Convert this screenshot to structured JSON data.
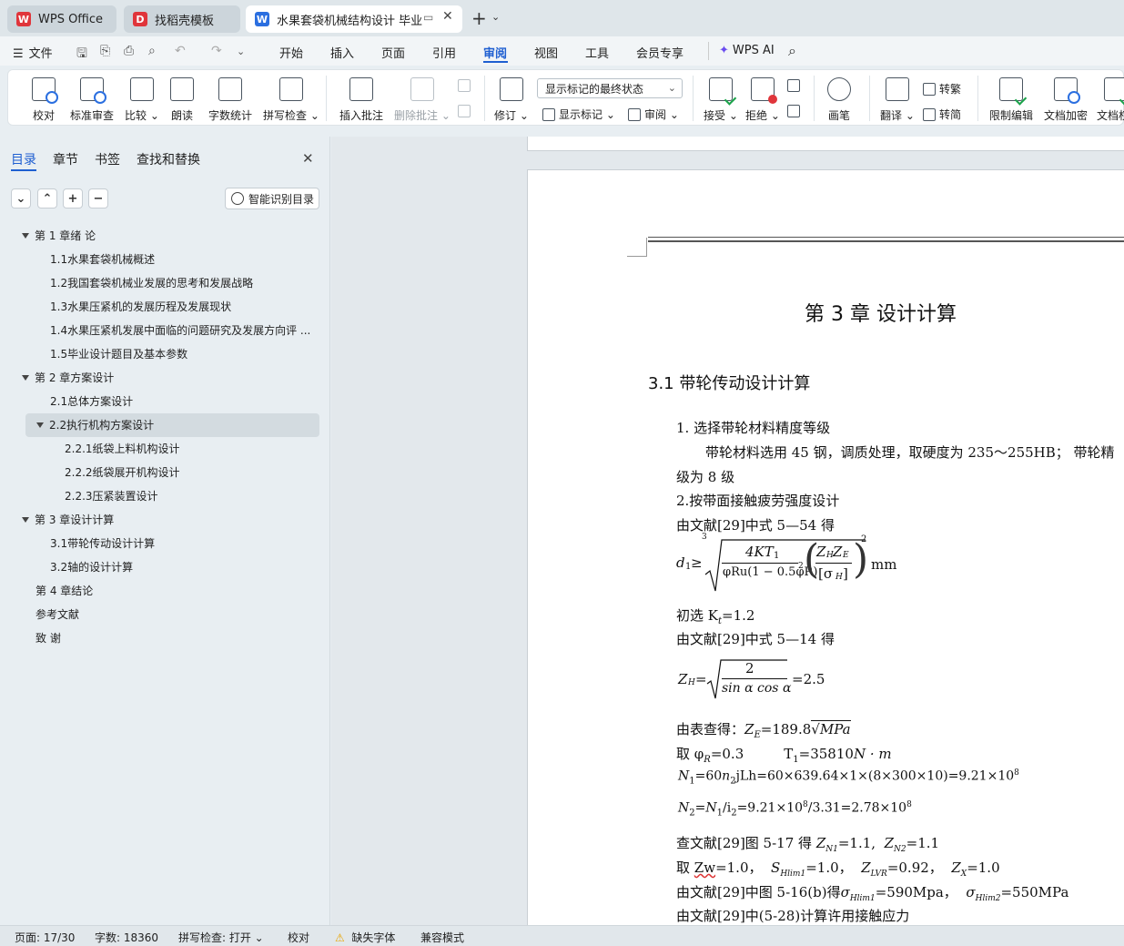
{
  "tabs": [
    {
      "label": "WPS Office",
      "logo": "W"
    },
    {
      "label": "找稻壳模板",
      "logo": "D"
    },
    {
      "label": "水果套袋机械结构设计 毕业",
      "logo": "W"
    }
  ],
  "colors": {
    "accent": "#1f5fd1",
    "wps_red": "#e0353b",
    "word_blue": "#2b6fe0"
  },
  "menu": {
    "file": "文件",
    "items": [
      "开始",
      "插入",
      "页面",
      "引用",
      "审阅",
      "视图",
      "工具",
      "会员专享"
    ],
    "active": "审阅",
    "wps_ai": "WPS AI"
  },
  "ribbon": {
    "proofread": "校对",
    "standard_review": "标准审查",
    "compare": "比较",
    "read_aloud": "朗读",
    "word_count": "字数统计",
    "spell_check": "拼写检查",
    "insert_comment": "插入批注",
    "delete_comment": "删除批注",
    "revise": "修订",
    "display_state": "显示标记的最终状态",
    "show_markup": "显示标记",
    "review": "审阅",
    "accept": "接受",
    "reject": "拒绝",
    "pen": "画笔",
    "translate": "翻译",
    "to_traditional": "转繁",
    "to_simplified": "转简",
    "restrict_edit": "限制编辑",
    "doc_encrypt": "文档加密",
    "doc_permission": "文档权"
  },
  "sidebar": {
    "tabs": [
      "目录",
      "章节",
      "书签",
      "查找和替换"
    ],
    "ai_button": "智能识别目录",
    "toc": [
      {
        "text": "第 1 章绪  论",
        "level": 1,
        "expanded": true
      },
      {
        "text": "1.1水果套袋机械概述",
        "level": 2
      },
      {
        "text": "1.2我国套袋机械业发展的思考和发展战略",
        "level": 2
      },
      {
        "text": "1.3水果压紧机的发展历程及发展现状",
        "level": 2
      },
      {
        "text": "1.4水果压紧机发展中面临的问题研究及发展方向评 ...",
        "level": 2
      },
      {
        "text": "1.5毕业设计题目及基本参数",
        "level": 2
      },
      {
        "text": "第 2 章方案设计",
        "level": 1,
        "expanded": true
      },
      {
        "text": "2.1总体方案设计",
        "level": 2
      },
      {
        "text": "2.2执行机构方案设计",
        "level": 2,
        "expanded": true,
        "selected": true
      },
      {
        "text": "2.2.1纸袋上料机构设计",
        "level": 3
      },
      {
        "text": "2.2.2纸袋展开机构设计",
        "level": 3
      },
      {
        "text": "2.2.3压紧装置设计",
        "level": 3
      },
      {
        "text": "第 3 章设计计算",
        "level": 1,
        "expanded": true
      },
      {
        "text": "3.1带轮传动设计计算",
        "level": 2
      },
      {
        "text": "3.2轴的设计计算",
        "level": 2
      },
      {
        "text": "第 4 章结论",
        "level": 1
      },
      {
        "text": "参考文献",
        "level": 1
      },
      {
        "text": "致  谢",
        "level": 1
      }
    ]
  },
  "document": {
    "chapter_title": "第 3 章  设计计算",
    "section_title": "3.1  带轮传动设计计算",
    "p1": "1. 选择带轮材料精度等级",
    "p2": "带轮材料选用 45 钢，调质处理，取硬度为 235～255HB；  带轮精",
    "p3": "级为 8 级",
    "p4": "2.按带面接触疲劳强度设计",
    "p5": "由文献[29]中式 5—54 得",
    "f1_left": "d",
    "f1_sub": "1",
    "f1_ge": "≥",
    "f1_root_index": "3",
    "f1_num": "4KT",
    "f1_num_sub": "1",
    "f1_den": "φRu(1 − 0.5φR)",
    "f1_den_exp": "2",
    "f1_rnum": "Z",
    "f1_rnum_a": "H",
    "f1_rnum_b": "E",
    "f1_rden": "[σ",
    "f1_rden_sub": "H",
    "f1_rden_end": "]",
    "f1_exp": "2",
    "f1_unit": "mm",
    "p6": "初选 K",
    "p6_sub": "t",
    "p6_val": "=1.2",
    "p7": "由文献[29]中式 5—14 得",
    "f2_left": "Z",
    "f2_left_sub": "H",
    "f2_eq": "=",
    "f2_num": "2",
    "f2_den": "sin α cos α",
    "f2_val": "=2.5",
    "p8": "由表查得：",
    "p8_z": "Z",
    "p8_zsub": "E",
    "p8_val": "=189.8",
    "p8_root": "MPa",
    "p9": "取 φ",
    "p9_sub": "R",
    "p9_val": "=0.3",
    "p9_t": "T",
    "p9_tsub": "1",
    "p9_tval": "=35810",
    "p9_unit": "N · m",
    "p10": "N",
    "p10_sub": "1",
    "p10_val": "=60",
    "p10_n": "n",
    "p10_nsub": "2",
    "p10_rest": "jLh=60×639.64×1×(8×300×10)=9.21×10",
    "p10_exp": "8",
    "p11": "N",
    "p11_sub": "2",
    "p11_eq": "=",
    "p11_n": "N",
    "p11_nsub": "1",
    "p11_i": "/i",
    "p11_isub": "2",
    "p11_rest": "=9.21×10",
    "p11_exp1": "8",
    "p11_rest2": "/3.31=2.78×10",
    "p11_exp2": "8",
    "p12": "查文献[29]图 5-17 得",
    "p12_z1": "Z",
    "p12_z1sub": "N1",
    "p12_z1val": "=1.1,",
    "p12_z2": "Z",
    "p12_z2sub": "N2",
    "p12_z2val": "=1.1",
    "p13": "取",
    "p13_zw": "Zw",
    "p13_zwval": "=1.0，",
    "p13_s": "S",
    "p13_ssub": "Hlim1",
    "p13_sval": "=1.0，",
    "p13_zl": "Z",
    "p13_zlsub": "LVR",
    "p13_zlval": "=0.92，",
    "p13_zx": "Z",
    "p13_zxsub": "X",
    "p13_zxval": "=1.0",
    "p14": "由文献[29]中图 5-16(b)得",
    "p14_s1": "σ",
    "p14_s1sub": "Hlim1",
    "p14_s1val": "=590Mpa，",
    "p14_s2": "σ",
    "p14_s2sub": "Hlim2",
    "p14_s2val": "=550MPa",
    "p15": "由文献[29]中(5-28)计算许用接触应力"
  },
  "status": {
    "page": "页面: 17/30",
    "words": "字数: 18360",
    "spell": "拼写检查: 打开",
    "proof": "校对",
    "missing_font": "缺失字体",
    "compat": "兼容模式"
  }
}
